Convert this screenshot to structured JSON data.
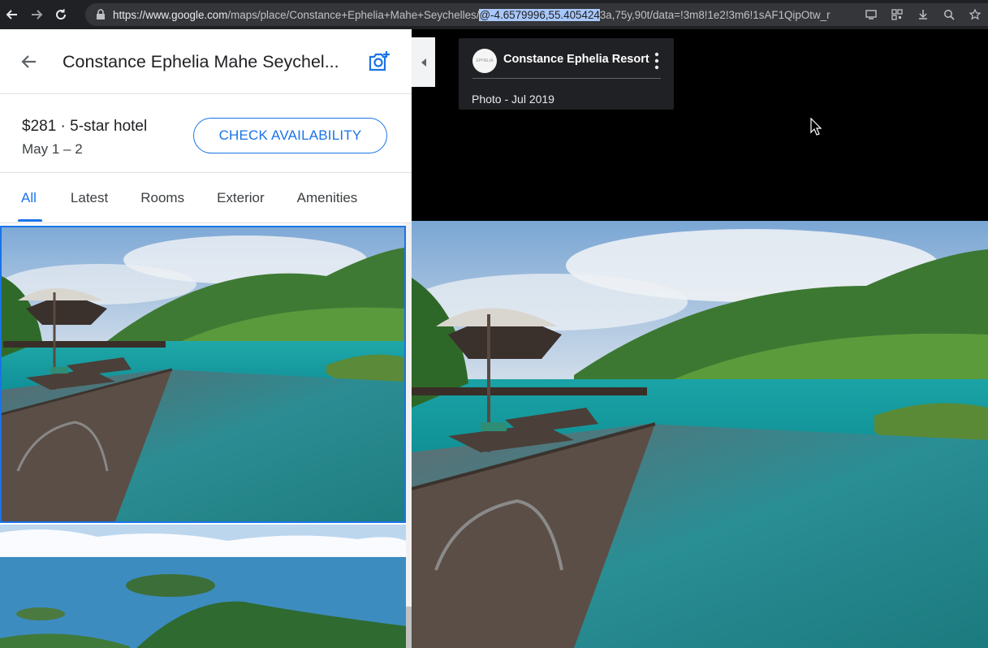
{
  "browser": {
    "url_host": "https://www.google.com",
    "url_path": "/maps/place/Constance+Ephelia+Mahe+Seychelles/",
    "url_selected": "@-4.6579996,55.405424",
    "url_rest": "3a,75y,90t/data=!3m8!1e2!3m6!1sAF1QipOtw_r",
    "icons": [
      "back-icon",
      "forward-icon",
      "reload-icon",
      "lock-icon",
      "cast-icon",
      "qr-icon",
      "install-icon",
      "zoom-icon",
      "star-icon"
    ]
  },
  "header": {
    "title": "Constance Ephelia Mahe Seychel...",
    "back_icon": "arrow-left-icon",
    "add_photo_icon": "camera-plus-icon"
  },
  "hotel": {
    "price": "$281 · 5-star hotel",
    "dates": "May 1 – 2",
    "cta": "CHECK AVAILABILITY"
  },
  "tabs": [
    {
      "label": "All",
      "active": true
    },
    {
      "label": "Latest"
    },
    {
      "label": "Rooms"
    },
    {
      "label": "Exterior"
    },
    {
      "label": "Amenities"
    }
  ],
  "viewer": {
    "owner": "Constance Ephelia Resort",
    "avatar_text": "EPHELIA",
    "photo_date": "Photo - Jul 2019"
  },
  "colors": {
    "accent": "#1a73e8",
    "browser_bg": "#202124",
    "card_bg": "#202124"
  }
}
